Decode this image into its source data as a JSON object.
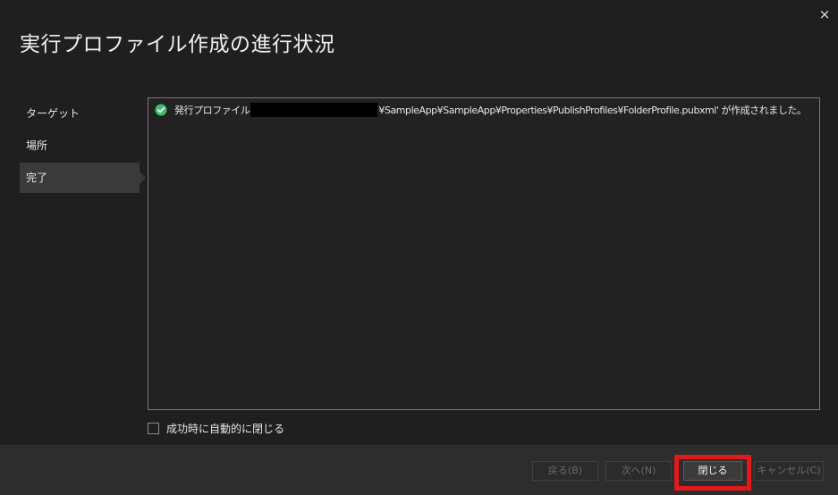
{
  "window": {
    "title": "実行プロファイル作成の進行状況",
    "close_icon": "×"
  },
  "steps": [
    {
      "label": "ターゲット",
      "active": false
    },
    {
      "label": "場所",
      "active": false
    },
    {
      "label": "完了",
      "active": true
    }
  ],
  "log": {
    "status_icon": "success-check-icon",
    "prefix": "発行プロファイル",
    "suffix": "¥SampleApp¥SampleApp¥Properties¥PublishProfiles¥FolderProfile.pubxml' が作成されました。"
  },
  "options": {
    "auto_close_label": "成功時に自動的に閉じる",
    "auto_close_checked": false
  },
  "buttons": {
    "back": "戻る(B)",
    "next": "次へ(N)",
    "close": "閉じる",
    "cancel": "キャンセル(C)"
  },
  "colors": {
    "success": "#3fbf6f",
    "highlight": "#e01a1a"
  }
}
